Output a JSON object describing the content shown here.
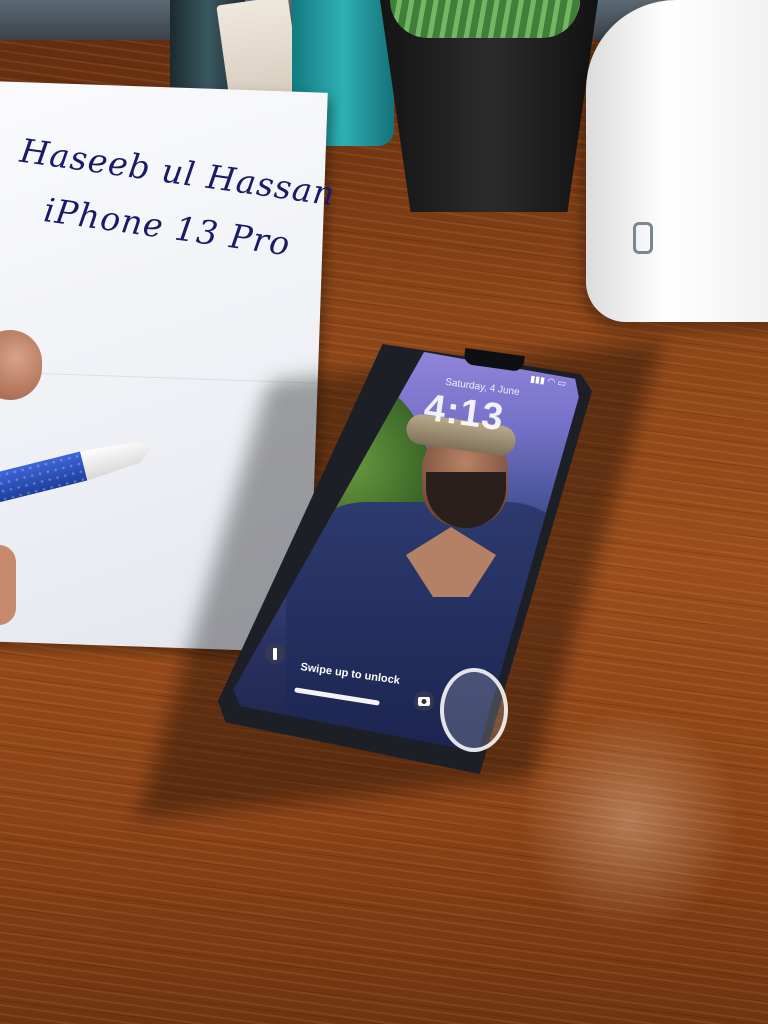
{
  "note": {
    "line1": "Haseeb ul Hassan",
    "line2": "iPhone 13 Pro"
  },
  "phone": {
    "lock_screen": {
      "date": "Saturday, 4 June",
      "time": "4:13",
      "swipe_text": "Swipe up to unlock",
      "status_icons": "▮▮▮ ◠ ▭"
    },
    "controls": {
      "flashlight_icon": "flashlight-icon",
      "camera_icon": "camera-icon"
    }
  },
  "colors": {
    "ink": "#1a1a66",
    "table_wood": "#8a4418",
    "pen_blue": "#2b4fbf"
  }
}
